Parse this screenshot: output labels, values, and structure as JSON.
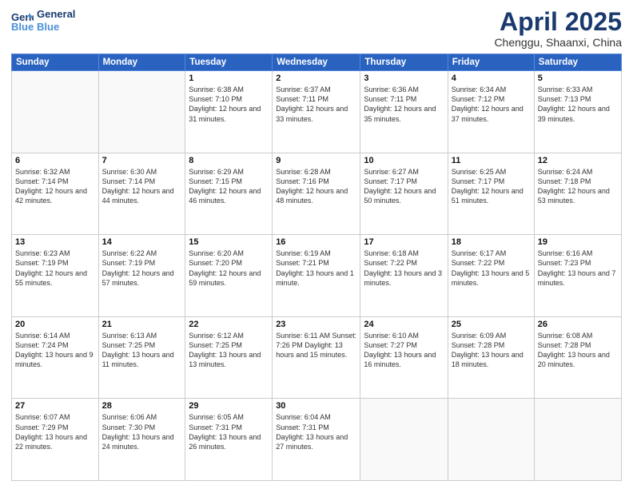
{
  "logo": {
    "line1": "General",
    "line2": "Blue"
  },
  "title": "April 2025",
  "subtitle": "Chenggu, Shaanxi, China",
  "days_of_week": [
    "Sunday",
    "Monday",
    "Tuesday",
    "Wednesday",
    "Thursday",
    "Friday",
    "Saturday"
  ],
  "weeks": [
    [
      {
        "num": "",
        "info": ""
      },
      {
        "num": "",
        "info": ""
      },
      {
        "num": "1",
        "info": "Sunrise: 6:38 AM\nSunset: 7:10 PM\nDaylight: 12 hours\nand 31 minutes."
      },
      {
        "num": "2",
        "info": "Sunrise: 6:37 AM\nSunset: 7:11 PM\nDaylight: 12 hours\nand 33 minutes."
      },
      {
        "num": "3",
        "info": "Sunrise: 6:36 AM\nSunset: 7:11 PM\nDaylight: 12 hours\nand 35 minutes."
      },
      {
        "num": "4",
        "info": "Sunrise: 6:34 AM\nSunset: 7:12 PM\nDaylight: 12 hours\nand 37 minutes."
      },
      {
        "num": "5",
        "info": "Sunrise: 6:33 AM\nSunset: 7:13 PM\nDaylight: 12 hours\nand 39 minutes."
      }
    ],
    [
      {
        "num": "6",
        "info": "Sunrise: 6:32 AM\nSunset: 7:14 PM\nDaylight: 12 hours\nand 42 minutes."
      },
      {
        "num": "7",
        "info": "Sunrise: 6:30 AM\nSunset: 7:14 PM\nDaylight: 12 hours\nand 44 minutes."
      },
      {
        "num": "8",
        "info": "Sunrise: 6:29 AM\nSunset: 7:15 PM\nDaylight: 12 hours\nand 46 minutes."
      },
      {
        "num": "9",
        "info": "Sunrise: 6:28 AM\nSunset: 7:16 PM\nDaylight: 12 hours\nand 48 minutes."
      },
      {
        "num": "10",
        "info": "Sunrise: 6:27 AM\nSunset: 7:17 PM\nDaylight: 12 hours\nand 50 minutes."
      },
      {
        "num": "11",
        "info": "Sunrise: 6:25 AM\nSunset: 7:17 PM\nDaylight: 12 hours\nand 51 minutes."
      },
      {
        "num": "12",
        "info": "Sunrise: 6:24 AM\nSunset: 7:18 PM\nDaylight: 12 hours\nand 53 minutes."
      }
    ],
    [
      {
        "num": "13",
        "info": "Sunrise: 6:23 AM\nSunset: 7:19 PM\nDaylight: 12 hours\nand 55 minutes."
      },
      {
        "num": "14",
        "info": "Sunrise: 6:22 AM\nSunset: 7:19 PM\nDaylight: 12 hours\nand 57 minutes."
      },
      {
        "num": "15",
        "info": "Sunrise: 6:20 AM\nSunset: 7:20 PM\nDaylight: 12 hours\nand 59 minutes."
      },
      {
        "num": "16",
        "info": "Sunrise: 6:19 AM\nSunset: 7:21 PM\nDaylight: 13 hours\nand 1 minute."
      },
      {
        "num": "17",
        "info": "Sunrise: 6:18 AM\nSunset: 7:22 PM\nDaylight: 13 hours\nand 3 minutes."
      },
      {
        "num": "18",
        "info": "Sunrise: 6:17 AM\nSunset: 7:22 PM\nDaylight: 13 hours\nand 5 minutes."
      },
      {
        "num": "19",
        "info": "Sunrise: 6:16 AM\nSunset: 7:23 PM\nDaylight: 13 hours\nand 7 minutes."
      }
    ],
    [
      {
        "num": "20",
        "info": "Sunrise: 6:14 AM\nSunset: 7:24 PM\nDaylight: 13 hours\nand 9 minutes."
      },
      {
        "num": "21",
        "info": "Sunrise: 6:13 AM\nSunset: 7:25 PM\nDaylight: 13 hours\nand 11 minutes."
      },
      {
        "num": "22",
        "info": "Sunrise: 6:12 AM\nSunset: 7:25 PM\nDaylight: 13 hours\nand 13 minutes."
      },
      {
        "num": "23",
        "info": "Sunrise: 6:11 AM\nSunset: 7:26 PM\nDaylight: 13 hours\nand 15 minutes."
      },
      {
        "num": "24",
        "info": "Sunrise: 6:10 AM\nSunset: 7:27 PM\nDaylight: 13 hours\nand 16 minutes."
      },
      {
        "num": "25",
        "info": "Sunrise: 6:09 AM\nSunset: 7:28 PM\nDaylight: 13 hours\nand 18 minutes."
      },
      {
        "num": "26",
        "info": "Sunrise: 6:08 AM\nSunset: 7:28 PM\nDaylight: 13 hours\nand 20 minutes."
      }
    ],
    [
      {
        "num": "27",
        "info": "Sunrise: 6:07 AM\nSunset: 7:29 PM\nDaylight: 13 hours\nand 22 minutes."
      },
      {
        "num": "28",
        "info": "Sunrise: 6:06 AM\nSunset: 7:30 PM\nDaylight: 13 hours\nand 24 minutes."
      },
      {
        "num": "29",
        "info": "Sunrise: 6:05 AM\nSunset: 7:31 PM\nDaylight: 13 hours\nand 26 minutes."
      },
      {
        "num": "30",
        "info": "Sunrise: 6:04 AM\nSunset: 7:31 PM\nDaylight: 13 hours\nand 27 minutes."
      },
      {
        "num": "",
        "info": ""
      },
      {
        "num": "",
        "info": ""
      },
      {
        "num": "",
        "info": ""
      }
    ]
  ]
}
